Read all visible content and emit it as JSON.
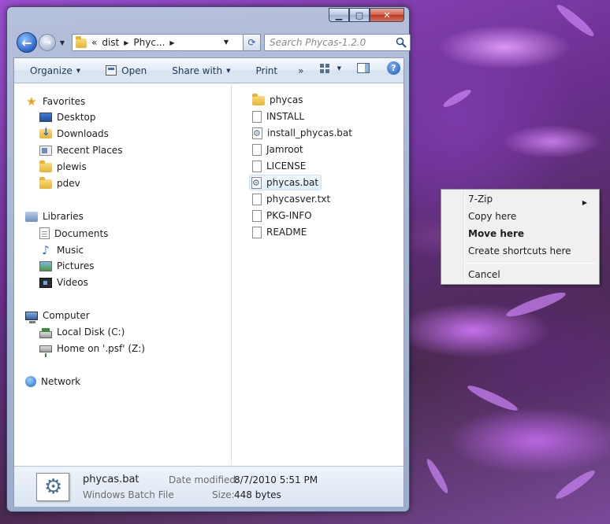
{
  "window": {
    "controls": {
      "minimize": "▁",
      "maximize": "▢",
      "close": "✕"
    }
  },
  "address_bar": {
    "overflow": "«",
    "crumbs": [
      "dist",
      "Phyc..."
    ],
    "search_placeholder": "Search Phycas-1.2.0"
  },
  "toolbar": {
    "organize": "Organize",
    "open": "Open",
    "share_with": "Share with",
    "print": "Print",
    "more": "»"
  },
  "nav_pane": {
    "favorites": {
      "label": "Favorites",
      "items": [
        "Desktop",
        "Downloads",
        "Recent Places",
        "plewis",
        "pdev"
      ]
    },
    "libraries": {
      "label": "Libraries",
      "items": [
        "Documents",
        "Music",
        "Pictures",
        "Videos"
      ]
    },
    "computer": {
      "label": "Computer",
      "items": [
        "Local Disk (C:)",
        "Home on '.psf' (Z:)"
      ]
    },
    "network": {
      "label": "Network"
    }
  },
  "files": [
    {
      "name": "phycas",
      "type": "folder"
    },
    {
      "name": "INSTALL",
      "type": "file"
    },
    {
      "name": "install_phycas.bat",
      "type": "bat"
    },
    {
      "name": "Jamroot",
      "type": "file"
    },
    {
      "name": "LICENSE",
      "type": "file"
    },
    {
      "name": "phycas.bat",
      "type": "bat",
      "selected": true
    },
    {
      "name": "phycasver.txt",
      "type": "file"
    },
    {
      "name": "PKG-INFO",
      "type": "file"
    },
    {
      "name": "README",
      "type": "file"
    }
  ],
  "details": {
    "name": "phycas.bat",
    "type": "Windows Batch File",
    "date_modified_label": "Date modified:",
    "date_modified": "8/7/2010 5:51 PM",
    "size_label": "Size:",
    "size": "448 bytes"
  },
  "context_menu": {
    "items": [
      "7-Zip",
      "Copy here",
      "Move here",
      "Create shortcuts here",
      "Cancel"
    ],
    "default_item": "Move here"
  }
}
